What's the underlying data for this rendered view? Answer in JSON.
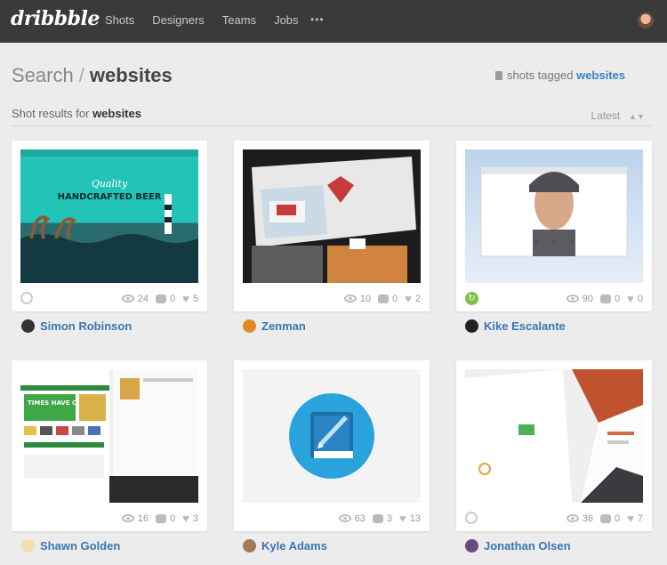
{
  "nav": {
    "logo": "dribbble",
    "items": [
      "Shots",
      "Designers",
      "Teams",
      "Jobs"
    ],
    "more": "•••"
  },
  "header": {
    "search_label": "Search",
    "separator": "/",
    "term": "websites",
    "tagged_prefix": "shots tagged",
    "tagged_term": "websites"
  },
  "subhead": {
    "prefix": "Shot results for",
    "term": "websites",
    "sort": "Latest"
  },
  "shots": [
    {
      "views": "24",
      "comments": "0",
      "likes": "5",
      "author": "Simon Robinson",
      "badge": "link"
    },
    {
      "views": "10",
      "comments": "0",
      "likes": "2",
      "author": "Zenman",
      "badge": "none"
    },
    {
      "views": "90",
      "comments": "0",
      "likes": "0",
      "author": "Kike Escalante",
      "badge": "rebound"
    },
    {
      "views": "16",
      "comments": "0",
      "likes": "3",
      "author": "Shawn Golden",
      "badge": "none"
    },
    {
      "views": "63",
      "comments": "3",
      "likes": "13",
      "author": "Kyle Adams",
      "badge": "none"
    },
    {
      "views": "36",
      "comments": "0",
      "likes": "7",
      "author": "Jonathan Olsen",
      "badge": "link"
    }
  ],
  "thumb_text": {
    "shot1_line1": "Quality",
    "shot1_line2": "HANDCRAFTED BEER",
    "shot4_banner": "TIMES HAVE CHANGED."
  },
  "colors": {
    "accent": "#3a82c4",
    "nav_bg": "#3a3a3a",
    "rebound": "#7cc24a"
  }
}
